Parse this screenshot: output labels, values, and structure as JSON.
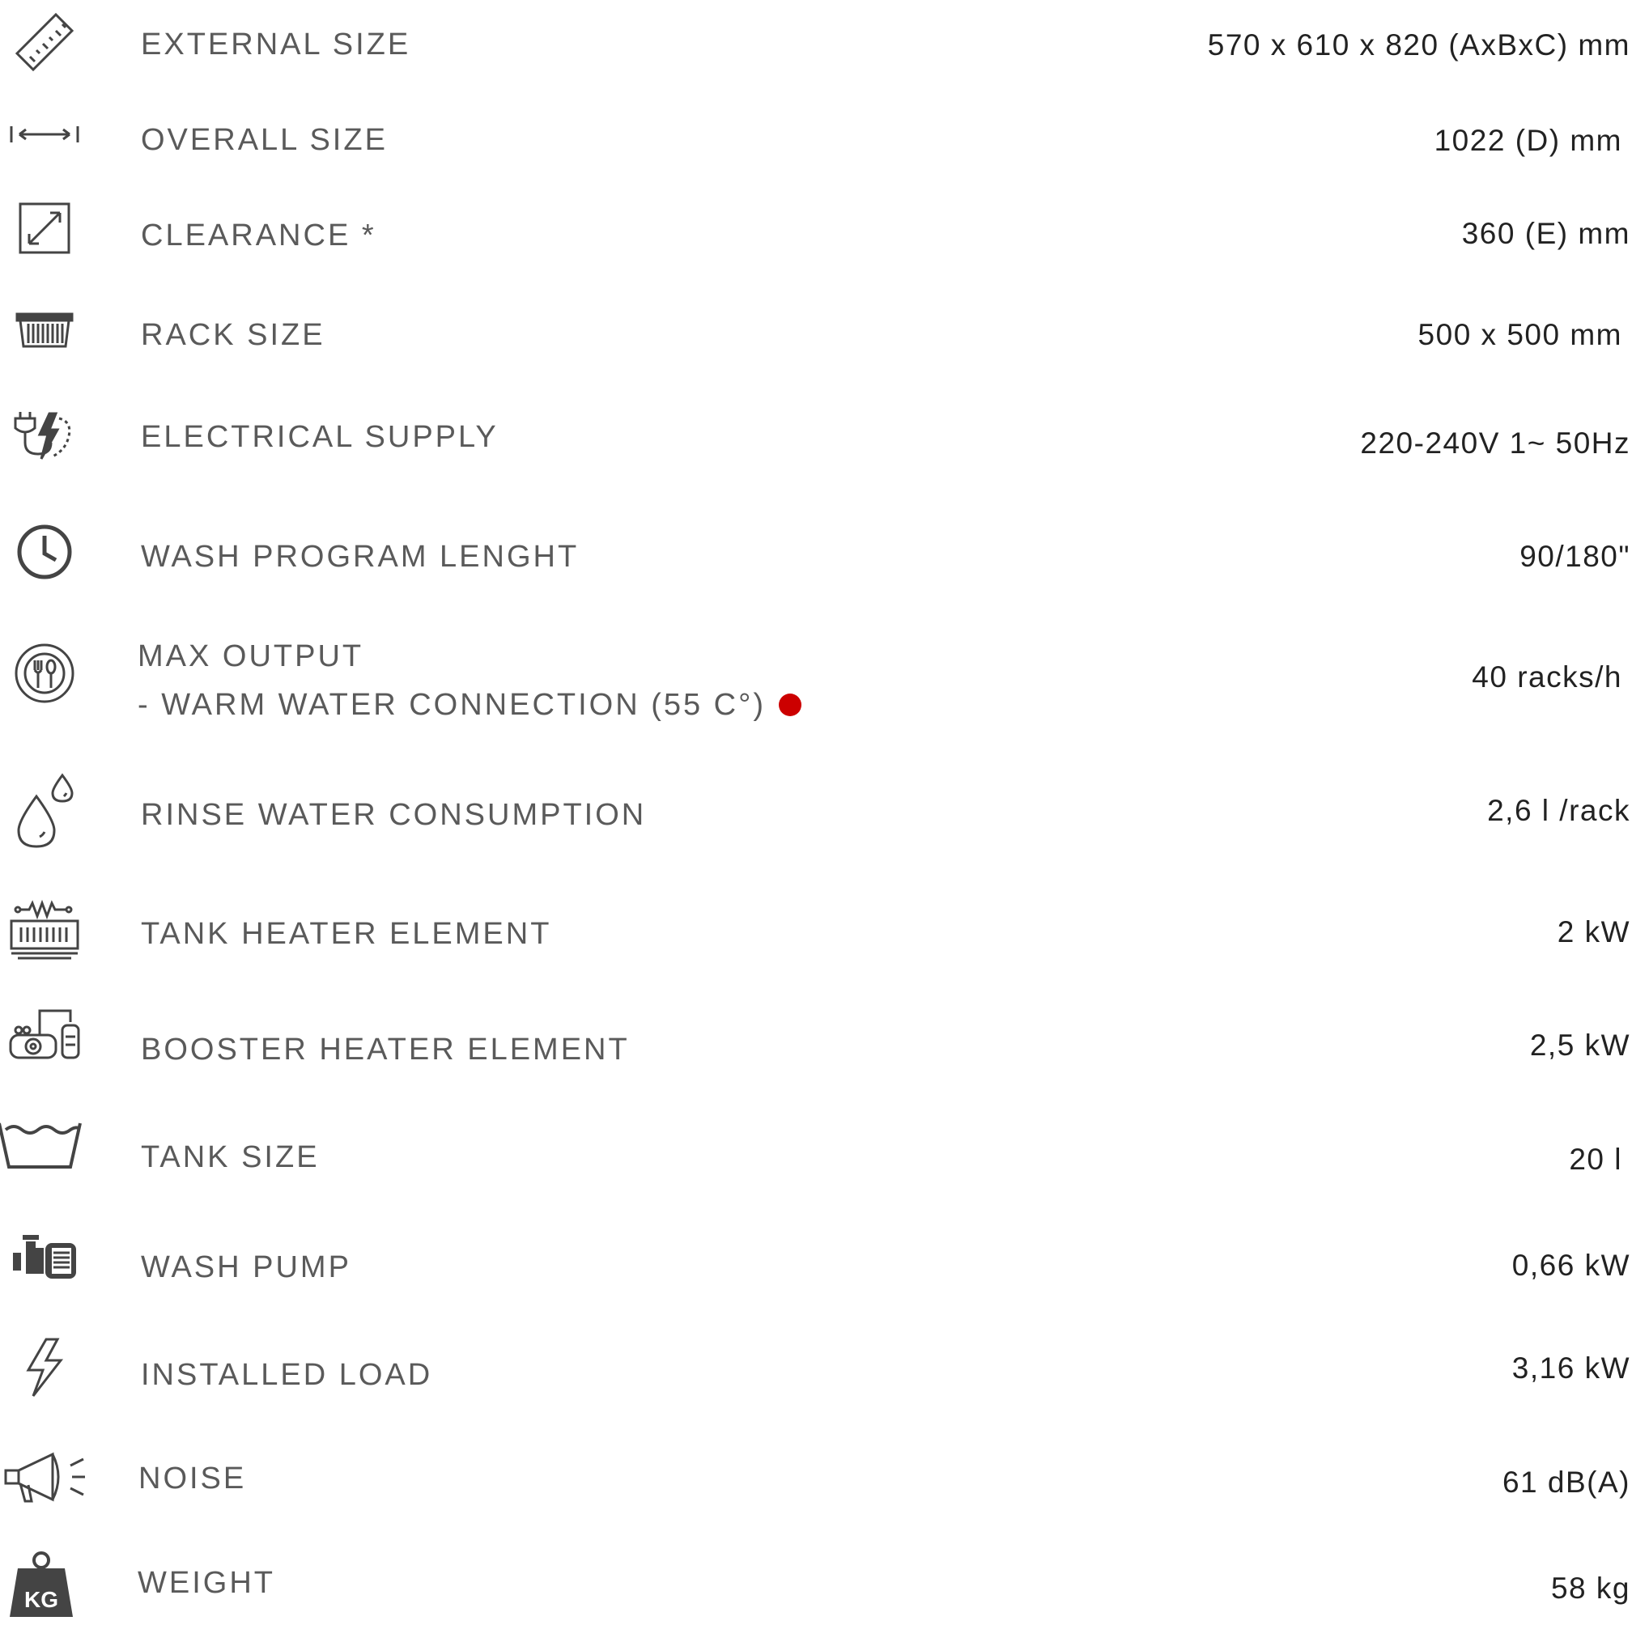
{
  "colors": {
    "label": "#5a5a5a",
    "value": "#222222",
    "icon": "#444444",
    "indicator": "#cc0000"
  },
  "specs": [
    {
      "icon": "ruler-icon",
      "label": "EXTERNAL SIZE",
      "value": "570 x 610 x 820 (AxBxC) mm"
    },
    {
      "icon": "horizontal-arrow-icon",
      "label": "OVERALL SIZE",
      "value": "1022 (D) mm"
    },
    {
      "icon": "diagonal-arrow-box-icon",
      "label": "CLEARANCE *",
      "value": "360 (E) mm"
    },
    {
      "icon": "rack-basket-icon",
      "label": "RACK SIZE",
      "value": "500 x 500 mm"
    },
    {
      "icon": "plug-lightning-icon",
      "label": "ELECTRICAL SUPPLY",
      "value": "220-240V 1~ 50Hz"
    },
    {
      "icon": "clock-icon",
      "label": "WASH PROGRAM LENGHT",
      "value": "90/180\""
    },
    {
      "icon": "plate-cutlery-icon",
      "label": "MAX OUTPUT",
      "sublabel": "- WARM WATER CONNECTION (55 C°)",
      "value": "40 racks/h"
    },
    {
      "icon": "water-drops-icon",
      "label": "RINSE WATER CONSUMPTION",
      "value": "2,6 l /rack"
    },
    {
      "icon": "heater-coil-icon",
      "label": "TANK HEATER ELEMENT",
      "value": "2 kW"
    },
    {
      "icon": "booster-heater-icon",
      "label": "BOOSTER HEATER ELEMENT",
      "value": "2,5 kW"
    },
    {
      "icon": "tank-water-icon",
      "label": "TANK SIZE",
      "value": "20 l"
    },
    {
      "icon": "pump-motor-icon",
      "label": "WASH PUMP",
      "value": "0,66 kW"
    },
    {
      "icon": "lightning-bolt-icon",
      "label": "INSTALLED LOAD",
      "value": "3,16 kW"
    },
    {
      "icon": "megaphone-icon",
      "label": "NOISE",
      "value": "61 dB(A)"
    },
    {
      "icon": "kg-weight-icon",
      "label": "WEIGHT",
      "value": "58 kg",
      "icon_text": "KG"
    }
  ]
}
